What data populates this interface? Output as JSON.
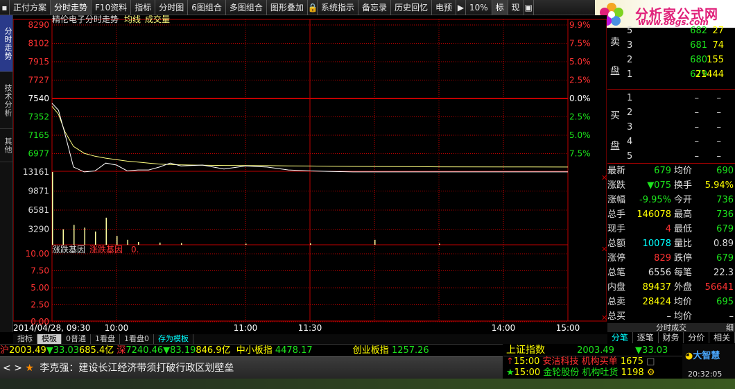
{
  "toolbar": {
    "items": [
      "正付方案",
      "分时走势",
      "F10资料",
      "指标",
      "分时图",
      "6图组合",
      "多图组合",
      "图形叠加",
      "系统指示",
      "备忘录",
      "历史回忆",
      "电预",
      "10%",
      "标",
      "现"
    ]
  },
  "logo": {
    "title": "分析家公式网",
    "url": "www.88gs.com"
  },
  "left_tabs": [
    "分时走势",
    "技术分析",
    "其他"
  ],
  "chart": {
    "title": "精伦电子分时走势",
    "avg_label": "均线",
    "vol_label": "成交量",
    "price_ticks": [
      "8290",
      "8102",
      "7915",
      "7727",
      "7540",
      "7352",
      "7165",
      "6977"
    ],
    "pct_ticks": [
      "9.9%",
      "7.5%",
      "5.0%",
      "2.5%",
      "0.0%",
      "2.5%",
      "5.0%",
      "7.5%"
    ],
    "vol_ticks": [
      "13161",
      "9871",
      "6581",
      "3290"
    ],
    "ind_title": "涨跌基因",
    "ind_name": "涨跌基因",
    "ind_value": "0.",
    "ind_ticks": [
      "10.00",
      "7.50",
      "5.00",
      "2.50",
      "0.00"
    ],
    "time_labels": [
      "2014/04/28, 09:30",
      "10:00",
      "11:00",
      "11:30",
      "14:00",
      "15:00"
    ],
    "colors": {
      "axis": "#c00000",
      "price": "#ffffff",
      "avg": "#ffff80",
      "vol": "#ffffa0",
      "up": "#ff3232",
      "down": "#1ce51c"
    }
  },
  "chart_data": {
    "type": "line",
    "title": "精伦电子分时走势",
    "xlabel": "",
    "ylabel": "",
    "ylim": [
      6788,
      8290
    ],
    "x": [
      "09:30",
      "09:33",
      "09:36",
      "09:40",
      "09:45",
      "09:50",
      "09:55",
      "10:00",
      "10:05",
      "10:10",
      "10:15",
      "10:20",
      "10:25",
      "10:30",
      "10:40",
      "10:50",
      "11:00",
      "11:10",
      "11:20",
      "11:30",
      "13:10",
      "13:20",
      "13:30",
      "13:40",
      "13:50",
      "14:00",
      "14:30",
      "15:00"
    ],
    "series": [
      {
        "name": "价格",
        "values": [
          7490,
          7420,
          7180,
          6840,
          6790,
          6800,
          6880,
          6860,
          6800,
          6810,
          6810,
          6840,
          6880,
          6850,
          6860,
          6820,
          6850,
          6840,
          6810,
          6800,
          6795,
          6790,
          6790,
          6790,
          6790,
          6790,
          6790,
          6790
        ]
      },
      {
        "name": "均线",
        "values": [
          7460,
          7380,
          7200,
          7050,
          6980,
          6950,
          6930,
          6915,
          6900,
          6890,
          6880,
          6870,
          6865,
          6862,
          6858,
          6856,
          6855,
          6854,
          6852,
          6850,
          6848,
          6846,
          6845,
          6844,
          6843,
          6842,
          6841,
          6840
        ]
      }
    ],
    "volume": {
      "x": [
        "09:30",
        "09:35",
        "09:40",
        "09:45",
        "09:50",
        "09:55",
        "10:00",
        "10:05",
        "10:10",
        "10:20",
        "10:30",
        "11:00",
        "11:30",
        "13:30",
        "14:00"
      ],
      "values": [
        13161,
        2800,
        3600,
        3100,
        2400,
        4900,
        1600,
        900,
        500,
        400,
        300,
        200,
        250,
        900,
        200
      ]
    }
  },
  "panel": {
    "sell": [
      {
        "label": "5",
        "price": "682",
        "vol": "27"
      },
      {
        "label": "3",
        "price": "681",
        "vol": "74"
      },
      {
        "label": "2",
        "price": "680",
        "vol": "155"
      },
      {
        "label": "1",
        "price": "679",
        "vol": "21444"
      }
    ],
    "sell_title": "卖盘",
    "buy_title": "买盘",
    "buy": [
      {
        "label": "1",
        "price": "–",
        "vol": "–"
      },
      {
        "label": "2",
        "price": "–",
        "vol": "–"
      },
      {
        "label": "3",
        "price": "–",
        "vol": "–"
      },
      {
        "label": "4",
        "price": "–",
        "vol": "–"
      },
      {
        "label": "5",
        "price": "–",
        "vol": "–"
      }
    ],
    "stats": [
      {
        "l1": "最新",
        "v1": "679",
        "c1": "g",
        "l2": "均价",
        "v2": "690",
        "c2": "g"
      },
      {
        "l1": "涨跌",
        "v1": "▼075",
        "c1": "g",
        "l2": "换手",
        "v2": "5.94%",
        "c2": "y"
      },
      {
        "l1": "涨幅",
        "v1": "-9.95%",
        "c1": "g",
        "l2": "今开",
        "v2": "736",
        "c2": "g"
      },
      {
        "l1": "总手",
        "v1": "146078",
        "c1": "y",
        "l2": "最高",
        "v2": "736",
        "c2": "g"
      },
      {
        "l1": "现手",
        "v1": "4",
        "c1": "r",
        "l2": "最低",
        "v2": "679",
        "c2": "g"
      },
      {
        "l1": "总额",
        "v1": "10078",
        "c1": "c",
        "l2": "量比",
        "v2": "0.89",
        "c2": "w"
      },
      {
        "l1": "涨停",
        "v1": "829",
        "c1": "r",
        "l2": "跌停",
        "v2": "679",
        "c2": "g"
      },
      {
        "l1": "总笔",
        "v1": "6556",
        "c1": "w",
        "l2": "每笔",
        "v2": "22.3",
        "c2": "w"
      },
      {
        "l1": "内盘",
        "v1": "89437",
        "c1": "y",
        "l2": "外盘",
        "v2": "56641",
        "c2": "r"
      },
      {
        "l1": "总卖",
        "v1": "28424",
        "c1": "y",
        "l2": "均价",
        "v2": "695",
        "c2": "g"
      },
      {
        "l1": "总买",
        "v1": "–",
        "c1": "w",
        "l2": "均价",
        "v2": "–",
        "c2": "w"
      }
    ],
    "trade_header": "分时成交",
    "detail_btn": "细"
  },
  "right_tabs": [
    "分笔",
    "逐笔",
    "财务",
    "分价",
    "相关"
  ],
  "bottom_tabs": [
    "指标",
    "模板",
    "0普通",
    "1看盘",
    "1看盘0",
    "存为模板"
  ],
  "ticker": {
    "sh_label": "沪",
    "sh_val": "2003.49",
    "sh_chg": "▼33.03",
    "sh_amt": "685.4亿",
    "sz_label": "深",
    "sz_val": "7240.46",
    "sz_chg": "▼83.19",
    "sz_amt": "846.9亿",
    "sme_label": "中小板指",
    "sme_val": "4478.17",
    "gem_label": "创业板指",
    "gem_val": "1257.26"
  },
  "news": {
    "text": "李克强：建设长江经济带须打破行政区划壁垒"
  },
  "index_box": {
    "name": "上证指数",
    "val": "2003.49",
    "chg": "▼33.03",
    "alert1_time": "15:00",
    "alert1_stock": "安洁科技",
    "alert1_type": "机构买单",
    "alert1_val": "1675",
    "alert2_time": "15:00",
    "alert2_stock": "金轮股份",
    "alert2_type": "机构吐货",
    "alert2_val": "1198"
  },
  "clock": {
    "brand": "大智慧",
    "time": "20:32:05"
  }
}
